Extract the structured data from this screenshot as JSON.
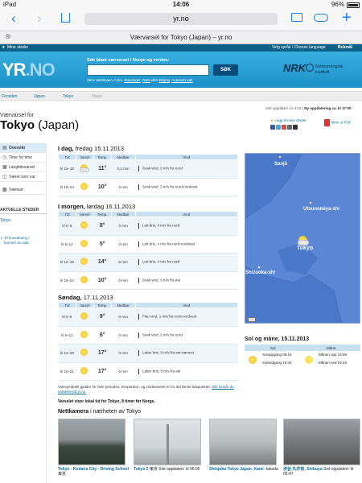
{
  "status": {
    "device": "iPad",
    "time": "14:06",
    "battery": "96%"
  },
  "browser": {
    "url": "yr.no",
    "tab_title": "Værvarsel for Tokyo (Japan) – yr.no"
  },
  "yr_top": {
    "my_places": "Mine steder",
    "language": "Velg språk / Choose language",
    "lang_value": "Bokmål"
  },
  "header": {
    "logo_prefix": "YR",
    "logo_suffix": ".NO",
    "search_label": "Søk blant værvarsel i Norge og verden:",
    "search_button": "SØK",
    "search_hint": "Skriv stedsnavn, f.eks.",
    "hint_links": [
      "Stavanger",
      "Røst",
      "eller",
      "Beijing",
      "Avansert søk"
    ],
    "nrk": "NRK",
    "met": [
      "Meteorologisk",
      "institutt"
    ]
  },
  "breadcrumbs": [
    "Forsiden",
    "Japan",
    "Tokyo",
    "Tokyo"
  ],
  "update": {
    "text": "Sist oppdatert i kl 4:03",
    "next": "Ny oppdatering ca. kl 17:00"
  },
  "location": {
    "subtitle": "Værvarsel for",
    "name": "Tokyo",
    "country": "(Japan)"
  },
  "actions": {
    "favorite": "Legg til mine steder",
    "pdf": "Skriv ut PDF"
  },
  "nav": {
    "items": [
      "Oversikt",
      "Time for time",
      "Langtidsvarsel",
      "Været som var",
      "Værkart"
    ],
    "recent_heading": "AKTUELLE STEDER",
    "recent_place": "Tokyo",
    "to_top": [
      "Til hovedmeny i",
      "bunnen av sida"
    ]
  },
  "table_headers": [
    "Tid",
    "Varsel",
    "Temp.",
    "Nedbør",
    "Vind"
  ],
  "days": [
    {
      "title": "I dag,",
      "date": "fredag 15.11.2013",
      "rows": [
        {
          "time": "kl 15–18",
          "symbol": "partly",
          "temp": "11°",
          "warm": true,
          "precip": "0,2 mm",
          "wind": "Svak vind, 3 m/s fra nord"
        },
        {
          "time": "kl 18–24",
          "symbol": "sun",
          "temp": "10°",
          "warm": true,
          "precip": "0 mm",
          "wind": "Svak vind, 3 m/s fra nord-nordvest"
        }
      ]
    },
    {
      "title": "I morgen,",
      "date": "lørdag 16.11.2013",
      "rows": [
        {
          "time": "kl 0–6",
          "symbol": "sun",
          "temp": "8°",
          "warm": true,
          "precip": "0 mm",
          "wind": "Lett bris, 4 m/s fra nord"
        },
        {
          "time": "kl 6–12",
          "symbol": "sun",
          "temp": "5°",
          "warm": true,
          "precip": "0 mm",
          "wind": "Lett bris, 4 m/s fra nord-nordvest"
        },
        {
          "time": "kl 12–18",
          "symbol": "sun",
          "temp": "14°",
          "warm": true,
          "precip": "0 mm",
          "wind": "Lett bris, 4 m/s fra nord"
        },
        {
          "time": "kl 18–24",
          "symbol": "sun",
          "temp": "10°",
          "warm": true,
          "precip": "0 mm",
          "wind": "Svak vind, 3 m/s fra øst"
        }
      ]
    },
    {
      "title": "Søndag,",
      "date": "17.11.2013",
      "rows": [
        {
          "time": "kl 0–6",
          "symbol": "sun",
          "temp": "9°",
          "warm": true,
          "precip": "0 mm",
          "wind": "Flau vind, 1 m/s fra nord-nordvest"
        },
        {
          "time": "kl 6–12",
          "symbol": "sun",
          "temp": "6°",
          "warm": true,
          "precip": "0 mm",
          "wind": "Svak vind, 2 m/s fra nord"
        },
        {
          "time": "kl 12–18",
          "symbol": "sun",
          "temp": "17°",
          "warm": true,
          "precip": "0 mm",
          "wind": "Laber bris, 8 m/s fra sør-sørvest"
        },
        {
          "time": "kl 15–21",
          "symbol": "sun",
          "temp": "17°",
          "warm": true,
          "precip": "0 mm",
          "wind": "Laber bris, 8 m/s fra sør"
        }
      ]
    }
  ],
  "map": {
    "cities": [
      "Sanjō",
      "Utsunomiya-shi",
      "Tokyo",
      "Shizuoka-shi"
    ]
  },
  "sun_moon": {
    "title": "Sol og måne, 15.11.2013",
    "sun_header": "Sol",
    "moon_header": "Måne",
    "sunrise": "Soloppgang 06:16",
    "sunset": "Solnedgang 16:34",
    "moonrise": "Månen opp 14:59",
    "moonset": "Månen ned 04:43"
  },
  "footnote": {
    "text": "Værsymbolet gjelder for hele perioden, temperatur- og vindvarselet er for det første tidspunktet.",
    "link": "Slik forstår du varslene på yr.no."
  },
  "local_time": "Varselet viser lokal tid for Tokyo, 8 timer før Norge.",
  "webcams": {
    "title": "Nettkamera",
    "subtitle": "i nærheten av Tokyo",
    "items": [
      {
        "name": "Tokyo - Kodaira City - Driving School",
        "sub": "東京"
      },
      {
        "name": "Tokyo 2",
        "sub": "東京  Sist oppdatert: kl 06:05"
      },
      {
        "name": "Shinjuku Tokyo Japan, Kami-",
        "sub": "takada"
      },
      {
        "name": "渋谷  丸井前, Shibuya",
        "sub": "Sist oppdatert: kl 05:47"
      }
    ]
  }
}
